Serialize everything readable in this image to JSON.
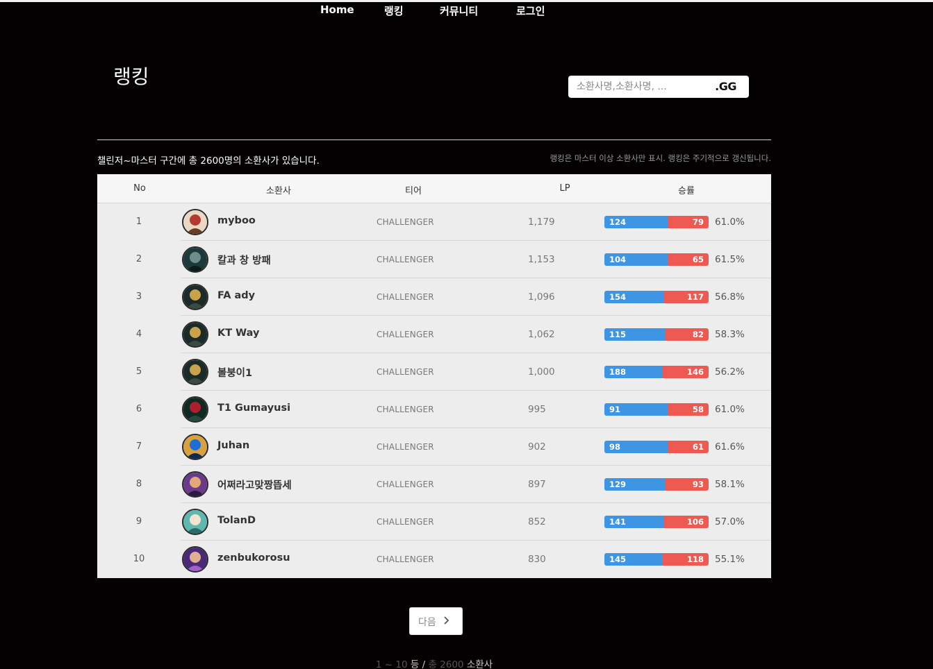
{
  "nav": {
    "home": "Home",
    "ranking": "랭킹",
    "community": "커뮤니티",
    "login": "로그인"
  },
  "page": {
    "title": "랭킹",
    "search_placeholder": "소환사명,소환사명, ...",
    "search_suffix": ".GG",
    "summary": "챌린저~마스터 구간에 총 2600명의 소환사가 있습니다.",
    "note": "랭킹은 마스터 이상 소환사만 표시. 랭킹은 주기적으로 갱신됩니다."
  },
  "table": {
    "headers": [
      "No",
      "소환사",
      "티어",
      "LP",
      "승률"
    ],
    "rows": [
      {
        "no": "1",
        "name": "myboo",
        "tier": "CHALLENGER",
        "lp": "1,179",
        "wins": "124",
        "losses": "79",
        "rate": "61.0%",
        "win_frac": 0.61,
        "avatar": "champion-icon-blonde"
      },
      {
        "no": "2",
        "name": "칼과 창 방패",
        "tier": "CHALLENGER",
        "lp": "1,153",
        "wins": "104",
        "losses": "65",
        "rate": "61.5%",
        "win_frac": 0.615,
        "avatar": "champion-icon-dark"
      },
      {
        "no": "3",
        "name": "FA ady",
        "tier": "CHALLENGER",
        "lp": "1,096",
        "wins": "154",
        "losses": "117",
        "rate": "56.8%",
        "win_frac": 0.568,
        "avatar": "champion-icon-gold"
      },
      {
        "no": "4",
        "name": "KT Way",
        "tier": "CHALLENGER",
        "lp": "1,062",
        "wins": "115",
        "losses": "82",
        "rate": "58.3%",
        "win_frac": 0.583,
        "avatar": "champion-icon-gold"
      },
      {
        "no": "5",
        "name": "볼붕이1",
        "tier": "CHALLENGER",
        "lp": "1,000",
        "wins": "188",
        "losses": "146",
        "rate": "56.2%",
        "win_frac": 0.562,
        "avatar": "champion-icon-gold"
      },
      {
        "no": "6",
        "name": "T1 Gumayusi",
        "tier": "CHALLENGER",
        "lp": "995",
        "wins": "91",
        "losses": "58",
        "rate": "61.0%",
        "win_frac": 0.61,
        "avatar": "champion-icon-rose"
      },
      {
        "no": "7",
        "name": "Juhan",
        "tier": "CHALLENGER",
        "lp": "902",
        "wins": "98",
        "losses": "61",
        "rate": "61.6%",
        "win_frac": 0.616,
        "avatar": "champion-icon-blue"
      },
      {
        "no": "8",
        "name": "어쩌라고맞짱뜹세",
        "tier": "CHALLENGER",
        "lp": "897",
        "wins": "129",
        "losses": "93",
        "rate": "58.1%",
        "win_frac": 0.581,
        "avatar": "champion-icon-purple"
      },
      {
        "no": "9",
        "name": "TolanD",
        "tier": "CHALLENGER",
        "lp": "852",
        "wins": "141",
        "losses": "106",
        "rate": "57.0%",
        "win_frac": 0.57,
        "avatar": "champion-icon-teal"
      },
      {
        "no": "10",
        "name": "zenbukorosu",
        "tier": "CHALLENGER",
        "lp": "830",
        "wins": "145",
        "losses": "118",
        "rate": "55.1%",
        "win_frac": 0.551,
        "avatar": "champion-icon-violet"
      }
    ]
  },
  "pager": {
    "next_label": "다음",
    "range": "1 ~ 10",
    "range_unit": "등 /",
    "total_prefix": "총",
    "total": "2600",
    "total_unit": "소환사"
  },
  "colors": {
    "win": "#3d95e4",
    "loss": "#ee5a52",
    "background": "#030102"
  }
}
